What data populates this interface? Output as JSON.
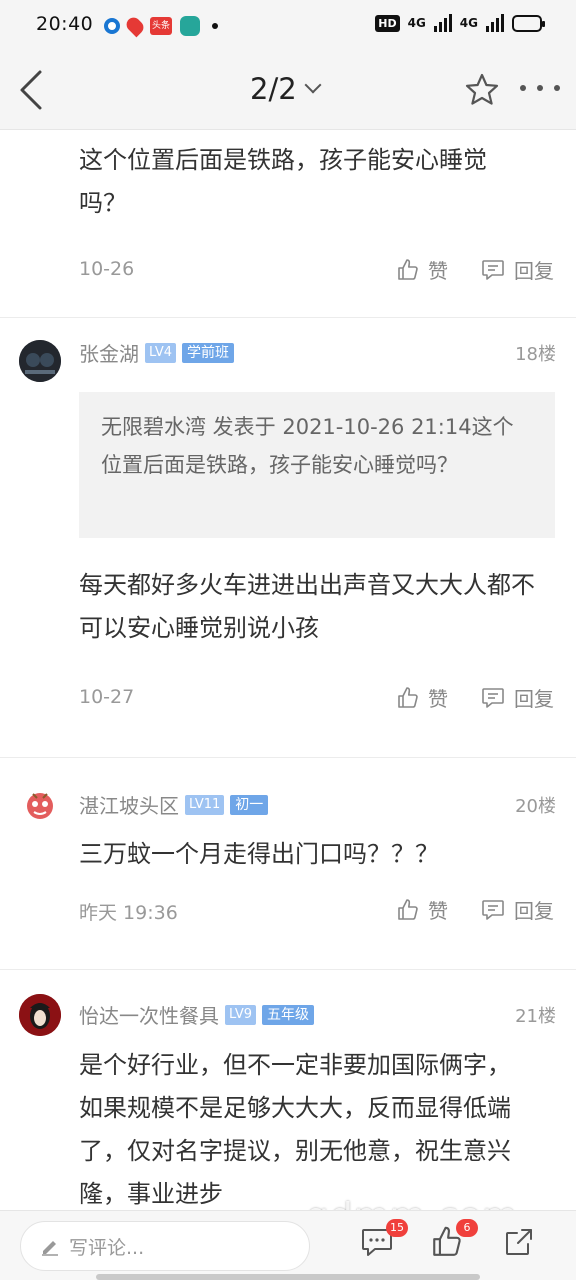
{
  "status_bar": {
    "time": "20:40",
    "toutiao_label": "头条",
    "hd": "HD",
    "network1": "4G",
    "network2": "4G"
  },
  "header": {
    "page_indicator": "2/2"
  },
  "comments": [
    {
      "text": "这个位置后面是铁路，孩子能安心睡觉吗？",
      "date": "10-26",
      "like_label": "赞",
      "reply_label": "回复"
    },
    {
      "username": "张金湖",
      "level": "LV4",
      "tag": "学前班",
      "floor": "18楼",
      "quote": "无限碧水湾 发表于 2021-10-26 21:14这个位置后面是铁路，孩子能安心睡觉吗？",
      "text": "每天都好多火车进进出出声音又大大人都不可以安心睡觉别说小孩",
      "date": "10-27",
      "like_label": "赞",
      "reply_label": "回复"
    },
    {
      "username": "湛江坡头区",
      "level": "LV11",
      "tag": "初一",
      "floor": "20楼",
      "text": "三万蚊一个月走得出门口吗？？？",
      "date": "昨天 19:36",
      "like_label": "赞",
      "reply_label": "回复"
    },
    {
      "username": "怡达一次性餐具",
      "level": "LV9",
      "tag": "五年级",
      "floor": "21楼",
      "text": "是个好行业，但不一定非要加国际俩字，如果规模不是足够大大大，反而显得低端了，仅对名字提议，别无他意，祝生意兴隆，事业进步"
    }
  ],
  "bottom_bar": {
    "comment_placeholder": "写评论...",
    "comment_count": "15",
    "like_count": "6"
  },
  "watermark": "gdmm.com"
}
